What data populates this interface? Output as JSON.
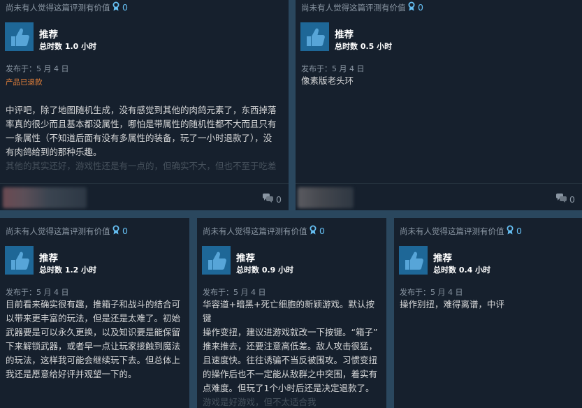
{
  "reviews": [
    {
      "helpful_text": "尚未有人觉得这篇评测有价值",
      "award_count": "0",
      "verdict": "推荐",
      "hours": "总时数 1.0 小时",
      "posted": "发布于：5 月 4 日",
      "status": "产品已退款",
      "text_lines": [
        "中评吧，除了地图随机生成，没有感觉到其他的肉鸽元素了，东西掉落",
        "率真的很少而且基本都没属性，哪怕是带属性的随机性都不大而且只有",
        "一条属性（不知道后面有没有多属性的装备，玩了一小时退款了），没",
        "有肉鸽给到的那种乐趣。"
      ],
      "faded_line": "其他的其实还好，游戏性还是有一点的，但确实不大，但也不至于吃差",
      "comment_count": "0"
    },
    {
      "helpful_text": "尚未有人觉得这篇评测有价值",
      "award_count": "0",
      "verdict": "推荐",
      "hours": "总时数 0.5 小时",
      "posted": "发布于：5 月 4 日",
      "text_lines": [
        "像素版老头环"
      ],
      "comment_count": "0"
    },
    {
      "helpful_text": "尚未有人觉得这篇评测有价值",
      "award_count": "0",
      "verdict": "推荐",
      "hours": "总时数 1.2 小时",
      "posted": "发布于：5 月 4 日",
      "text_lines": [
        "目前看来确实很有趣，推箱子和战斗的结合可",
        "以带来更丰富的玩法，但是还是太难了。初始",
        "武器要是可以永久更换，以及知识要是能保留",
        "下来解锁武器，或者早一点让玩家接触到魔法",
        "的玩法，这样我可能会继续玩下去。但总体上",
        "我还是愿意给好评并观望一下的。"
      ]
    },
    {
      "helpful_text": "尚未有人觉得这篇评测有价值",
      "award_count": "0",
      "verdict": "推荐",
      "hours": "总时数 0.9 小时",
      "posted": "发布于：5 月 4 日",
      "text_lines": [
        "华容道+暗黑+死亡细胞的新颖游戏。默认按键",
        "操作变扭，建议进游戏就改一下按键。“箱子”",
        "推来推去，还要注意高低差。敌人攻击很猛，",
        "且速度快。往往诱骗不当反被围攻。习惯变扭",
        "的操作后也不一定能从敌群之中突围，着实有",
        "点难度。但玩了1个小时后还是决定退款了。"
      ],
      "faded_line": "游戏是好游戏，但不太适合我"
    },
    {
      "helpful_text": "尚未有人觉得这篇评测有价值",
      "award_count": "0",
      "verdict": "推荐",
      "hours": "总时数 0.4 小时",
      "posted": "发布于：5 月 4 日",
      "text_lines": [
        "操作别扭，难得离谱，中评"
      ]
    }
  ],
  "colors": {
    "page_bg": "#2a475e",
    "card_bg": "#16202d",
    "accent": "#66c0f4",
    "refund": "#e5813a",
    "muted": "#8a96a3"
  },
  "icons": {
    "award": "award-ribbon-icon",
    "thumb": "thumbs-up-icon",
    "comment": "comment-bubbles-icon"
  }
}
